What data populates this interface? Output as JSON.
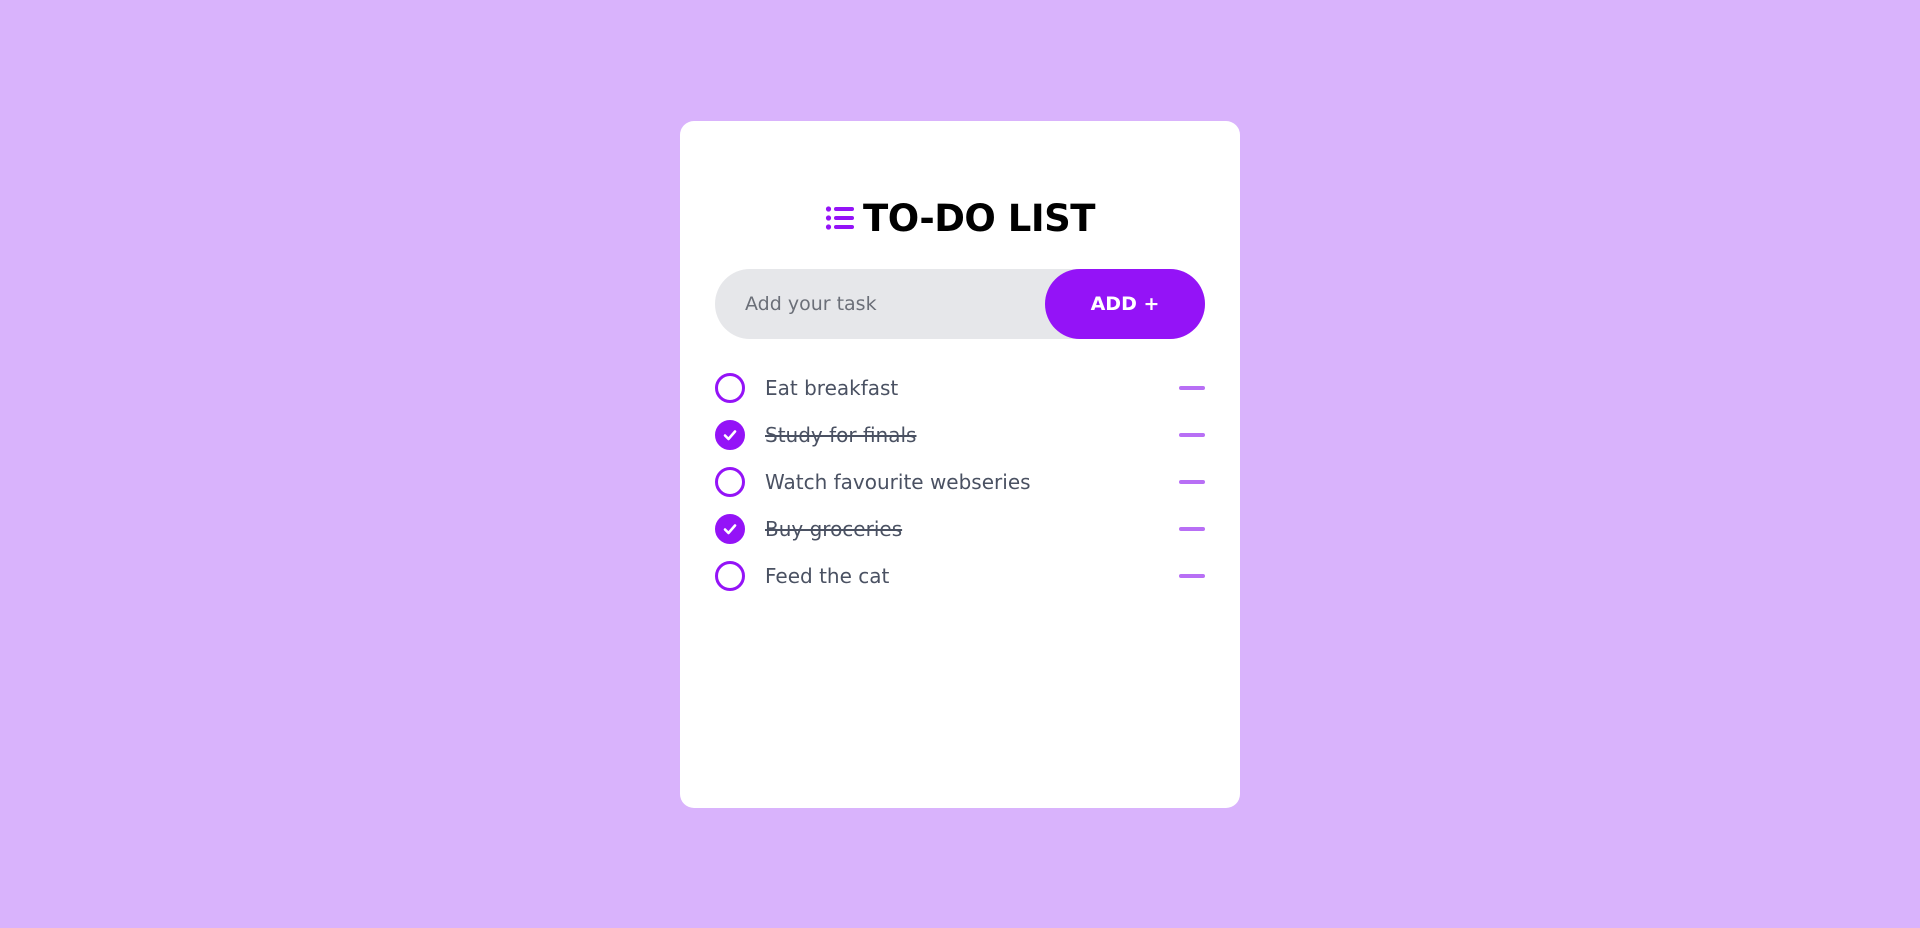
{
  "header": {
    "title": "TO-DO LIST",
    "icon": "list-icon"
  },
  "input": {
    "placeholder": "Add your task",
    "value": ""
  },
  "add_button": {
    "label": "ADD +"
  },
  "tasks": [
    {
      "label": "Eat breakfast",
      "done": false
    },
    {
      "label": "Study for finals",
      "done": true
    },
    {
      "label": "Watch favourite webseries",
      "done": false
    },
    {
      "label": "Buy groceries",
      "done": true
    },
    {
      "label": "Feed the cat",
      "done": false
    }
  ],
  "colors": {
    "background": "#d9b3fc",
    "accent": "#9413f7",
    "remove": "#b86ff5",
    "input_bg": "#e6e7ea",
    "card": "#ffffff"
  }
}
